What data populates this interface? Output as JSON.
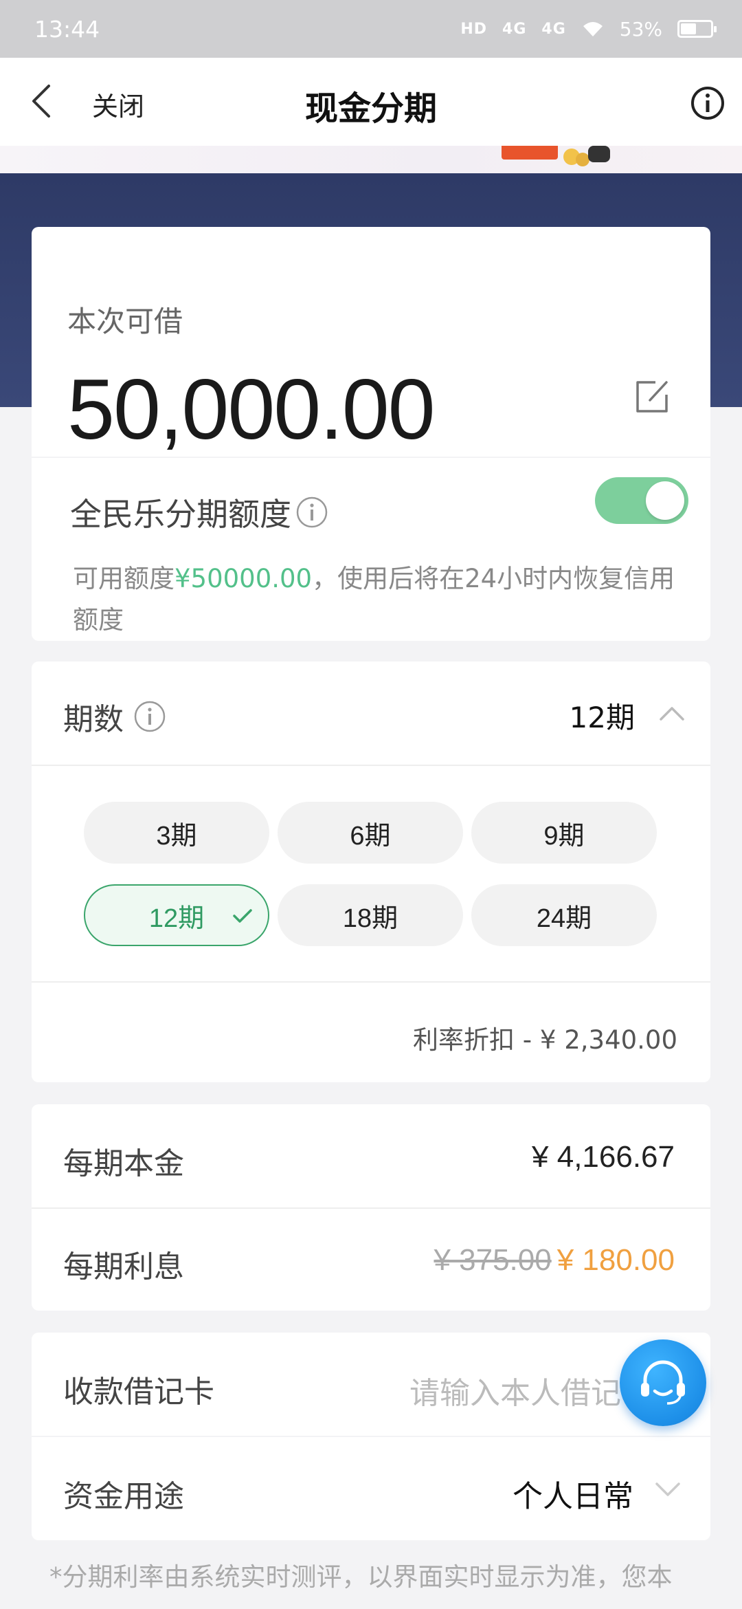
{
  "status_bar": {
    "time": "13:44",
    "hd_label": "HD",
    "signal1": "4G",
    "signal2": "4G",
    "battery": "53%"
  },
  "nav": {
    "close_label": "关闭",
    "title": "现金分期"
  },
  "amount": {
    "label": "本次可借",
    "value": "50,000.00"
  },
  "quota": {
    "title": "全民乐分期额度",
    "toggle_on": true,
    "desc_prefix": "可用额度",
    "desc_amount": "¥50000.00",
    "desc_suffix": "，使用后将在24小时内恢复信用额度"
  },
  "period": {
    "label": "期数",
    "value": "12期",
    "options": [
      "3期",
      "6期",
      "9期",
      "12期",
      "18期",
      "24期"
    ],
    "selected_index": 3,
    "discount": "利率折扣 - ¥ 2,340.00"
  },
  "principal": {
    "label": "每期本金",
    "value": "¥ 4,166.67"
  },
  "interest": {
    "label": "每期利息",
    "original": "¥ 375.00",
    "current": "¥ 180.00"
  },
  "debit_card": {
    "label": "收款借记卡",
    "placeholder": "请输入本人借记"
  },
  "purpose": {
    "label": "资金用途",
    "value": "个人日常"
  },
  "footnote": "*分期利率由系统实时测评，以界面实时显示为准，您本",
  "colors": {
    "accent_green": "#53c08a",
    "toggle_green": "#7dcf9c",
    "orange": "#f0a040",
    "banner_blue": "#2e3a66",
    "service_blue": "#1d8fe8"
  },
  "icons": {
    "back": "chevron-left-icon",
    "info": "info-icon",
    "edit": "edit-icon",
    "check": "check-icon",
    "chevron_up": "chevron-up-icon",
    "chevron_down": "chevron-down-icon",
    "service": "customer-service-icon"
  }
}
